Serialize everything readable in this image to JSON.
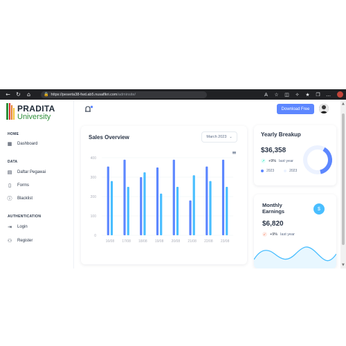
{
  "browser": {
    "url_host": "https://peserta38-fwd.ab5.nusaflkri.com",
    "url_path": "/adminsite/",
    "icons": [
      "back-icon",
      "refresh-icon",
      "home-icon"
    ]
  },
  "sidebar": {
    "brand_line1": "PRADITA",
    "brand_line2": "University",
    "sections": [
      {
        "title": "HOME",
        "items": [
          {
            "label": "Dashboard",
            "icon": "dashboard-icon"
          }
        ]
      },
      {
        "title": "DATA",
        "items": [
          {
            "label": "Daftar Pegawai",
            "icon": "table-icon"
          },
          {
            "label": "Forms",
            "icon": "file-icon"
          },
          {
            "label": "Blacklist",
            "icon": "alert-circle-icon"
          }
        ]
      },
      {
        "title": "AUTHENTICATION",
        "items": [
          {
            "label": "Login",
            "icon": "login-icon"
          },
          {
            "label": "Register",
            "icon": "user-plus-icon"
          }
        ]
      }
    ]
  },
  "topbar": {
    "download_label": "Download Free"
  },
  "sales": {
    "title": "Sales Overview",
    "month": "March 2023"
  },
  "chart_data": {
    "type": "bar",
    "title": "Sales Overview",
    "categories": [
      "16/08",
      "17/08",
      "18/08",
      "19/08",
      "20/08",
      "21/08",
      "22/08",
      "23/08"
    ],
    "y_ticks": [
      "0",
      "100",
      "200",
      "300",
      "400"
    ],
    "ylim": [
      0,
      400
    ],
    "grid": true,
    "series": [
      {
        "values": [
          355,
          390,
          300,
          350,
          390,
          180,
          355,
          390
        ],
        "color": "#5d87ff"
      },
      {
        "values": [
          280,
          250,
          325,
          215,
          250,
          310,
          280,
          250
        ],
        "color": "#49beff"
      }
    ]
  },
  "yearly": {
    "title": "Yearly Breakup",
    "value": "$36,358",
    "change": "+9%",
    "change_note": "last year",
    "legend": [
      {
        "label": "2023",
        "color": "#5d87ff"
      },
      {
        "label": "2023",
        "color": "#ecf2ff"
      }
    ],
    "donut_share": 0.38
  },
  "monthly": {
    "title": "Monthly Earnings",
    "value": "$6,820",
    "change": "+9%",
    "change_note": "last year",
    "icon": "dollar-icon"
  }
}
